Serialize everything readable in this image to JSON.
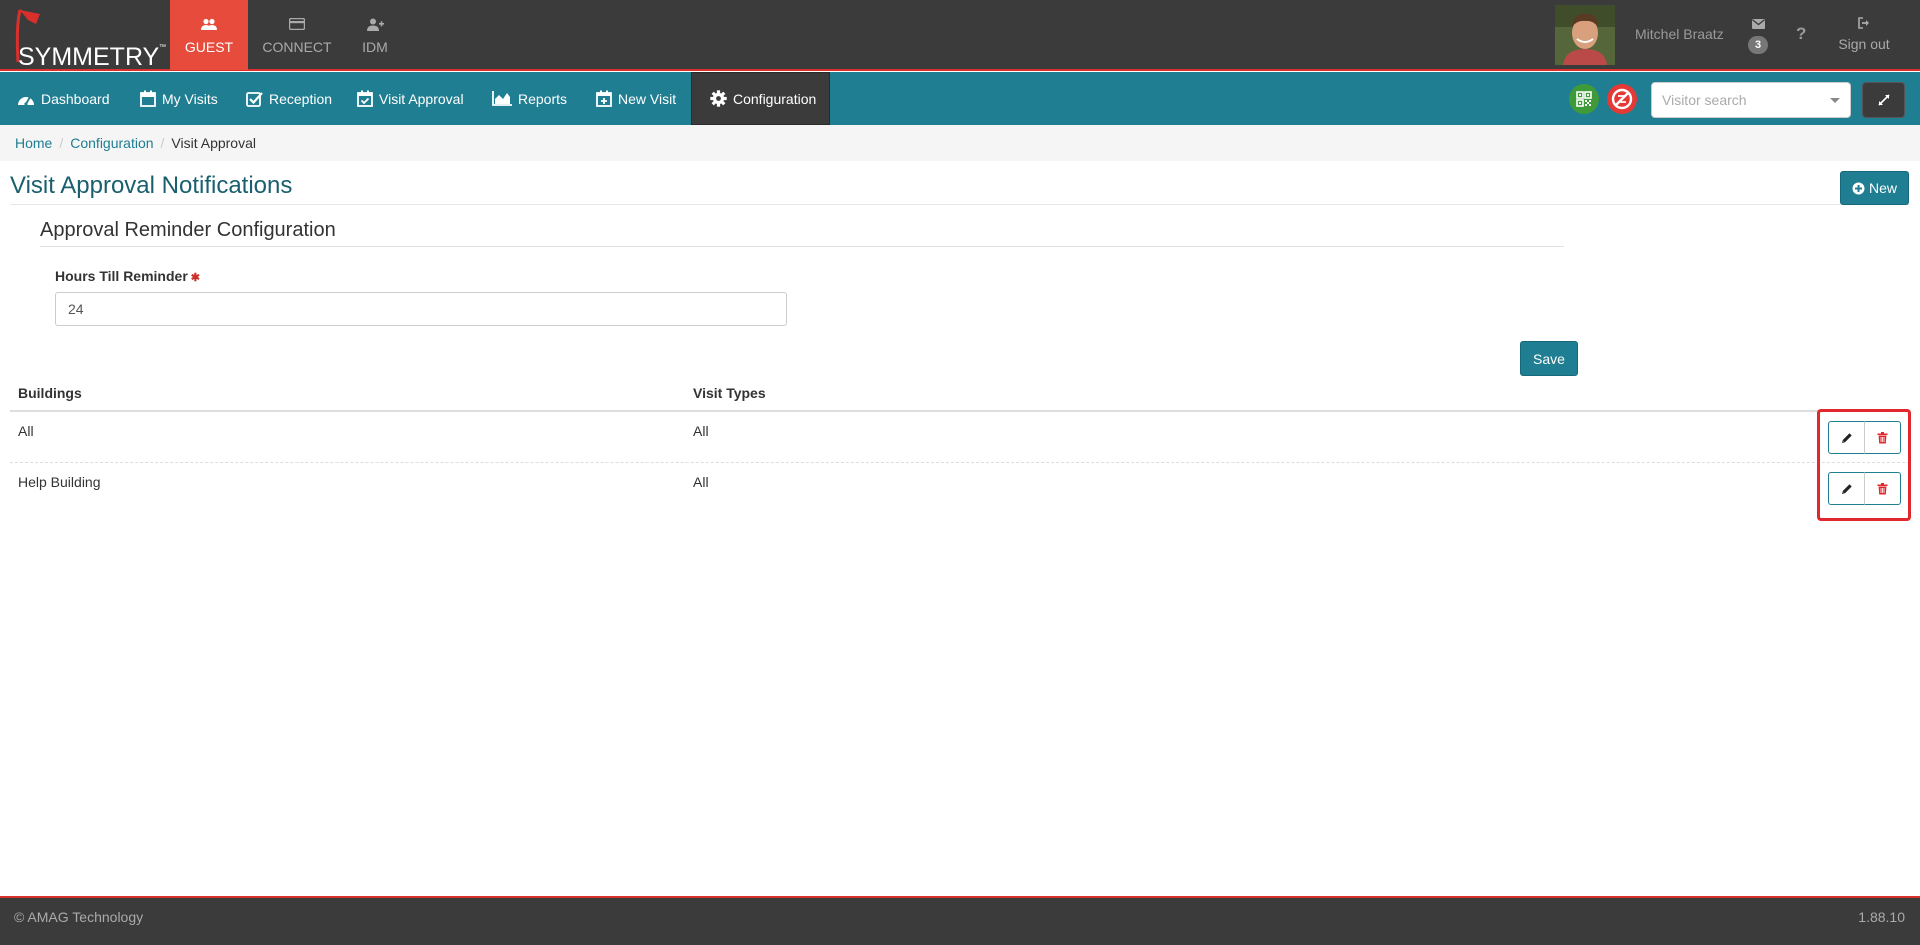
{
  "brand": {
    "logo_text": "SYMMETRY",
    "logo_tm": "™",
    "accent": "#e64b3c",
    "primary": "#1f7e91",
    "topbar_bg": "#3b3b3b"
  },
  "app_tabs": [
    {
      "label": "GUEST",
      "icon": "users-icon",
      "active": true
    },
    {
      "label": "CONNECT",
      "icon": "card-icon",
      "active": false
    },
    {
      "label": "IDM",
      "icon": "add-user-icon",
      "active": false
    }
  ],
  "user": {
    "name": "Mitchel Braatz",
    "message_count": "3",
    "help_label": "?",
    "signout_label": "Sign out"
  },
  "nav": [
    {
      "label": "Dashboard",
      "icon": "dashboard-icon"
    },
    {
      "label": "My Visits",
      "icon": "calendar-icon"
    },
    {
      "label": "Reception",
      "icon": "checkbox-icon"
    },
    {
      "label": "Visit Approval",
      "icon": "calendar-check-icon"
    },
    {
      "label": "Reports",
      "icon": "area-chart-icon"
    },
    {
      "label": "New Visit",
      "icon": "calendar-plus-icon"
    },
    {
      "label": "Configuration",
      "icon": "gear-icon",
      "active": true
    }
  ],
  "search": {
    "placeholder": "Visitor search"
  },
  "breadcrumb": {
    "home": "Home",
    "configuration": "Configuration",
    "current": "Visit Approval",
    "separator": "/"
  },
  "page": {
    "title": "Visit Approval Notifications",
    "new_label": "New"
  },
  "reminder": {
    "section_title": "Approval Reminder Configuration",
    "hours_label": "Hours Till Reminder",
    "required_marker": "✱",
    "hours_value": "24",
    "save_label": "Save"
  },
  "table": {
    "headers": {
      "buildings": "Buildings",
      "visit_types": "Visit Types"
    },
    "rows": [
      {
        "building": "All",
        "visit_type": "All"
      },
      {
        "building": "Help Building",
        "visit_type": "All"
      }
    ]
  },
  "footer": {
    "copyright": "© AMAG Technology",
    "version": "1.88.10"
  }
}
